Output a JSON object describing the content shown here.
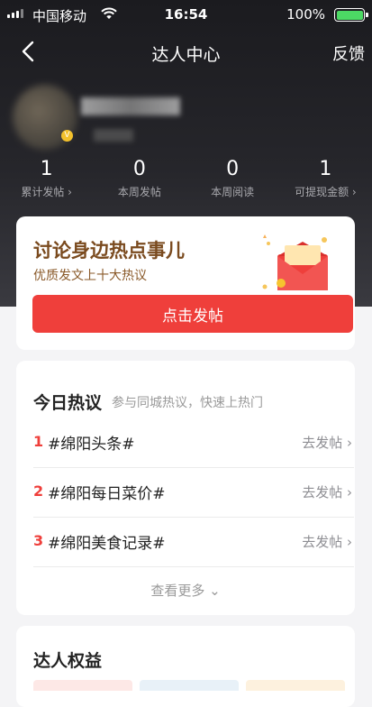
{
  "status_bar": {
    "carrier": "中国移动",
    "time": "16:54",
    "battery": "100%"
  },
  "nav": {
    "title": "达人中心",
    "feedback": "反馈"
  },
  "stats": [
    {
      "value": "1",
      "label": "累计发帖 ›"
    },
    {
      "value": "0",
      "label": "本周发帖"
    },
    {
      "value": "0",
      "label": "本周阅读"
    },
    {
      "value": "1",
      "label": "可提现金额 ›"
    }
  ],
  "post_card": {
    "title": "讨论身边热点事儿",
    "subtitle": "优质发文上十大热议",
    "button": "点击发帖"
  },
  "hot_topics": {
    "title": "今日热议",
    "description": "参与同城热议，快速上热门",
    "items": [
      {
        "rank": "1",
        "topic": "#绵阳头条#",
        "action": "去发帖 ›"
      },
      {
        "rank": "2",
        "topic": "#绵阳每日菜价#",
        "action": "去发帖 ›"
      },
      {
        "rank": "3",
        "topic": "#绵阳美食记录#",
        "action": "去发帖 ›"
      }
    ],
    "more": "查看更多 ⌄"
  },
  "rights": {
    "title": "达人权益"
  },
  "colors": {
    "accent_red": "#ef3f3b",
    "hero_dark": "#1b1b1f",
    "battery_green": "#4cd964"
  }
}
